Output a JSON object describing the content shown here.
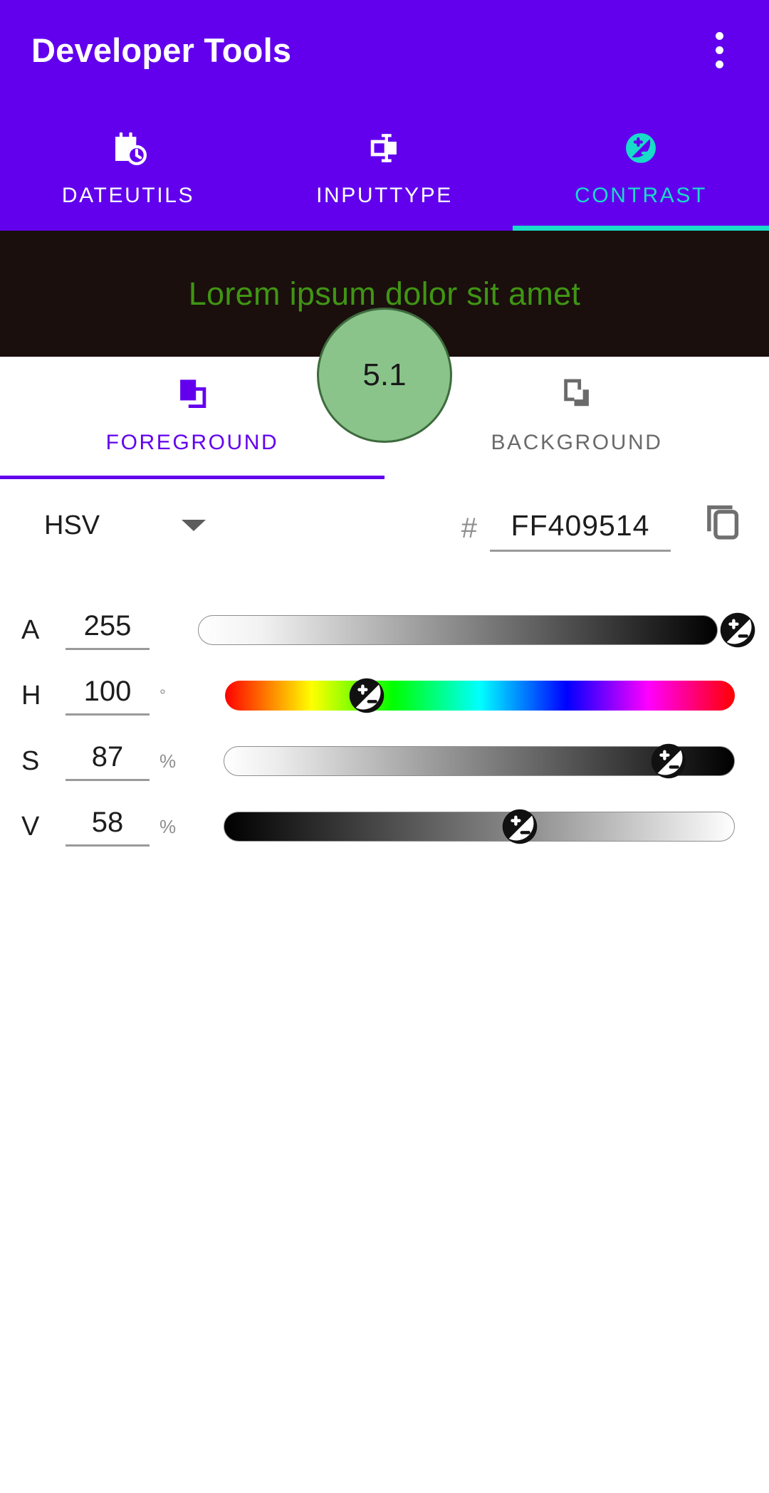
{
  "theme": {
    "brand": "#6200EE",
    "accent": "#18DCC8",
    "preview_bg": "#1A0F0D",
    "preview_fg": "#409514",
    "badge_bg": "#8BC48B",
    "badge_border": "#3E6B3E",
    "badge_text": "#1A1A1A"
  },
  "appbar": {
    "title": "Developer Tools",
    "overflow_icon": "more-vert-icon"
  },
  "tabs": [
    {
      "label": "DATEUTILS",
      "icon": "calendar-clock-icon",
      "active": false
    },
    {
      "label": "INPUTTYPE",
      "icon": "input-field-icon",
      "active": false
    },
    {
      "label": "CONTRAST",
      "icon": "contrast-icon",
      "active": true
    }
  ],
  "preview": {
    "text": "Lorem ipsum dolor sit amet",
    "score": "5.1"
  },
  "target_tabs": [
    {
      "label": "FOREGROUND",
      "icon": "layers-filled-icon",
      "active": true
    },
    {
      "label": "BACKGROUND",
      "icon": "layers-outline-icon",
      "active": false
    }
  ],
  "color_form": {
    "mode": "HSV",
    "mode_caret_icon": "chevron-down-icon",
    "hash_symbol": "#",
    "hex_value": "FF409514",
    "hex_placeholder": "FF409514",
    "copy_icon": "copy-icon"
  },
  "channels": [
    {
      "name": "A",
      "value": "255",
      "unit": "",
      "min": 0,
      "max": 255,
      "percent": 100,
      "gradient_type": "alpha",
      "thumb_icon": "contrast-thumb-icon"
    },
    {
      "name": "H",
      "value": "100",
      "unit": "°",
      "min": 0,
      "max": 360,
      "percent": 27.8,
      "gradient_type": "hue",
      "thumb_icon": "contrast-thumb-icon"
    },
    {
      "name": "S",
      "value": "87",
      "unit": "%",
      "min": 0,
      "max": 100,
      "percent": 87,
      "gradient_type": "saturation",
      "thumb_icon": "contrast-thumb-icon"
    },
    {
      "name": "V",
      "value": "58",
      "unit": "%",
      "min": 0,
      "max": 100,
      "percent": 58,
      "gradient_type": "value",
      "thumb_icon": "contrast-thumb-icon"
    }
  ]
}
